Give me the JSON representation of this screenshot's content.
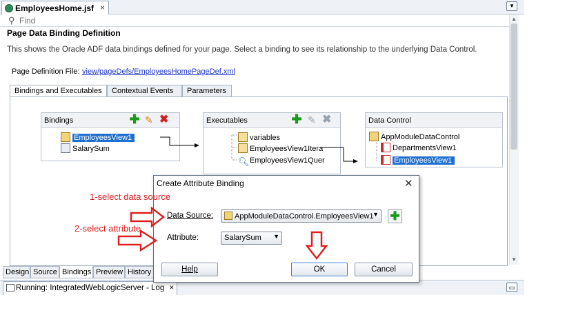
{
  "editor": {
    "doc_tab_title": "EmployeesHome.jsf",
    "doc_tab_close": "×",
    "tab_dropdown": "▼",
    "find_placeholder": "Find",
    "page_title": "Page Data Binding Definition",
    "description": "This shows the Oracle ADF data bindings defined for your page. Select a binding to see its relationship to the underlying Data Control.",
    "page_definition_label": "Page Definition File:",
    "page_definition_link": "view/pageDefs/EmployeesHomePageDef.xml",
    "tabs": [
      {
        "label": "Bindings and Executables",
        "active": true
      },
      {
        "label": "Contextual Events",
        "active": false
      },
      {
        "label": "Parameters",
        "active": false
      }
    ]
  },
  "bindings_panel": {
    "title": "Bindings",
    "items": [
      {
        "label": "EmployeesView1",
        "icon": "table-binding-icon",
        "selected": true
      },
      {
        "label": "SalarySum",
        "icon": "attribute-binding-icon",
        "selected": false
      }
    ]
  },
  "executables_panel": {
    "title": "Executables",
    "items": [
      {
        "label": "variables",
        "icon": "variables-icon"
      },
      {
        "label": "EmployeesView1Itera",
        "icon": "iterator-icon"
      },
      {
        "label": "EmployeesView1Quer",
        "icon": "query-icon"
      }
    ]
  },
  "data_control_panel": {
    "title": "Data Control",
    "root": "AppModuleDataControl",
    "items": [
      {
        "label": "DepartmentsView1",
        "selected": false
      },
      {
        "label": "EmployeesView1",
        "selected": true
      }
    ]
  },
  "bottom_tabs": [
    {
      "label": "Design",
      "active": false
    },
    {
      "label": "Source",
      "active": false
    },
    {
      "label": "Bindings",
      "active": true
    },
    {
      "label": "Preview",
      "active": false
    },
    {
      "label": "History",
      "active": false
    }
  ],
  "log": {
    "label": "Running: IntegratedWebLogicServer - Log",
    "close": "×",
    "minimize": "▭"
  },
  "dialog": {
    "title": "Create Attribute Binding",
    "close": "✕",
    "data_source_label": "Data Source:",
    "data_source_value": "AppModuleDataControl.EmployeesView1",
    "attribute_label": "Attribute:",
    "attribute_value": "SalarySum",
    "help_button": "Help",
    "ok_button": "OK",
    "cancel_button": "Cancel"
  },
  "annotations": {
    "step1": "1-select data source",
    "step2": "2-select attribute"
  },
  "colors": {
    "selection": "#1f6fd0",
    "annotation": "#e02020",
    "add_green": "#1a9a1a",
    "delete_red": "#d02020"
  }
}
